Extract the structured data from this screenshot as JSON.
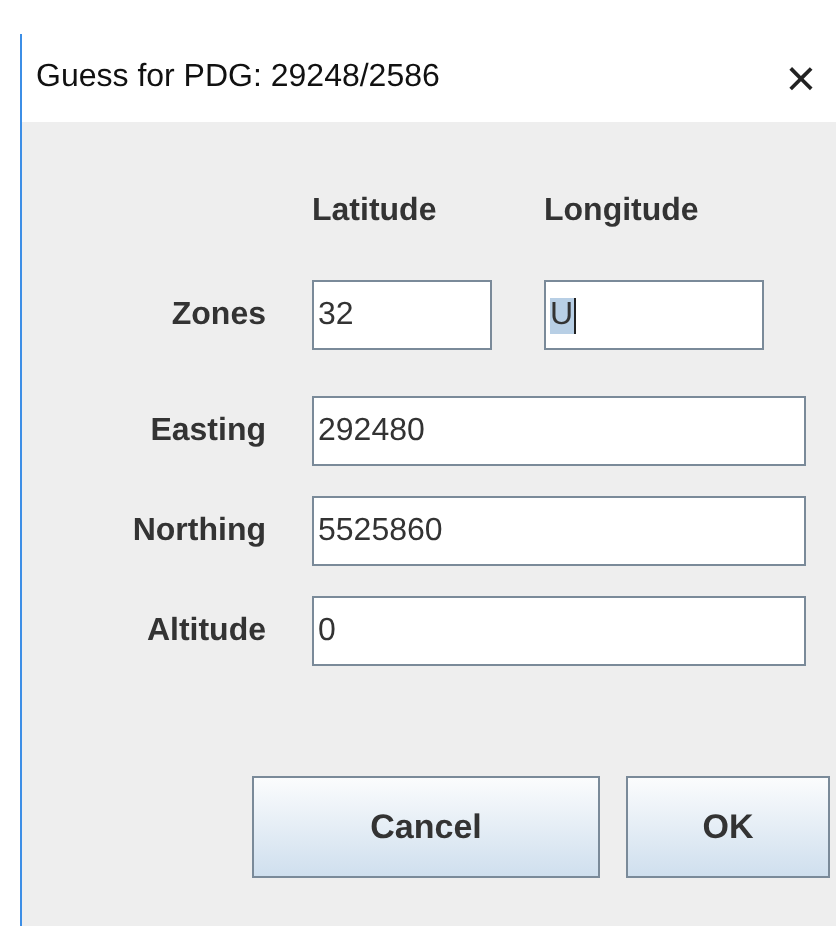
{
  "window": {
    "title": "Guess for PDG: 29248/2586",
    "close": "×"
  },
  "headers": [
    "Latitude",
    "Longitude"
  ],
  "zones": {
    "label": "Zones",
    "latitude": "32",
    "longitude": {
      "value": "U",
      "text_selected": true
    }
  },
  "fields": [
    {
      "label": "Easting",
      "value": "292480"
    },
    {
      "label": "Northing",
      "value": "5525860"
    },
    {
      "label": "Altitude",
      "value": "0"
    }
  ],
  "buttons": [
    "Cancel",
    "OK"
  ]
}
